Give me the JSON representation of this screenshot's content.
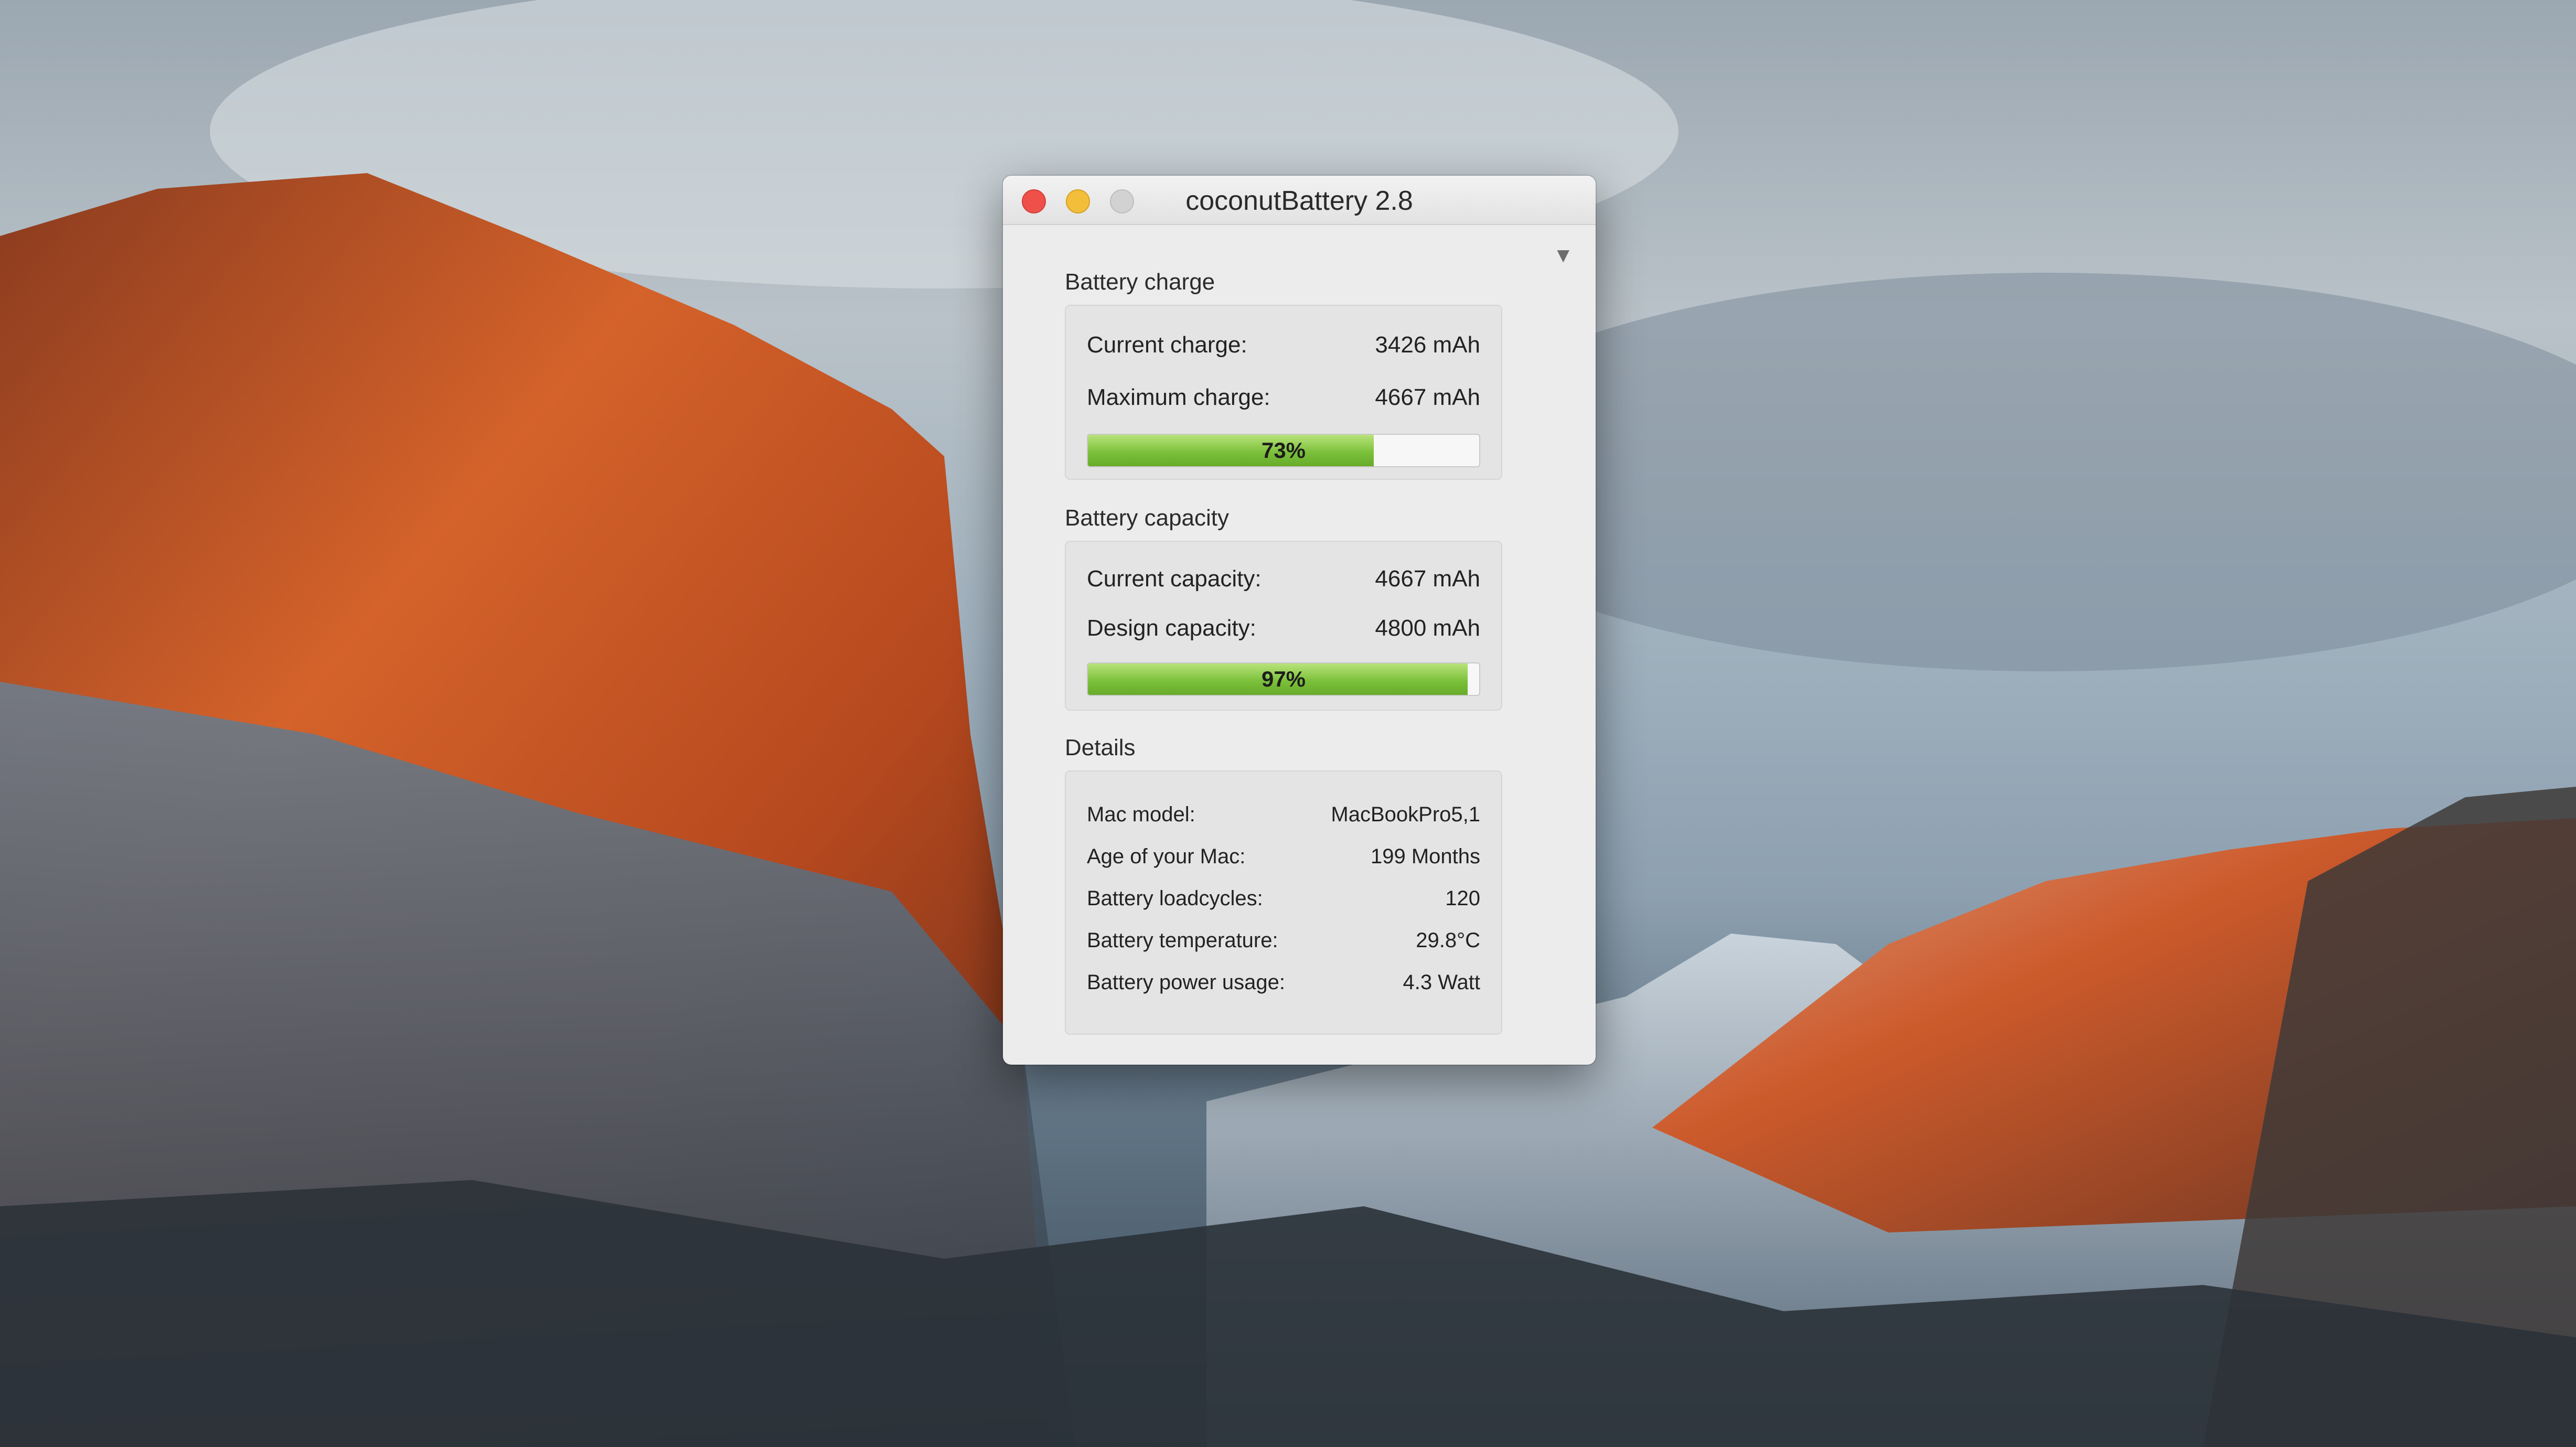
{
  "window": {
    "title": "coconutBattery 2.8"
  },
  "icons": {
    "close": "close-icon",
    "minimize": "minimize-icon",
    "zoom": "zoom-icon",
    "disclosure": "disclosure-triangle-icon",
    "disclosure_glyph": "▼"
  },
  "colors": {
    "close": "#f0504a",
    "minimize": "#f3be3a",
    "zoom": "#d2d2d2",
    "progress_green": "#7cc13b"
  },
  "battery_charge": {
    "title": "Battery charge",
    "current_label": "Current charge:",
    "current_value": "3426 mAh",
    "maximum_label": "Maximum charge:",
    "maximum_value": "4667 mAh",
    "percent_text": "73%",
    "percent": 73
  },
  "battery_capacity": {
    "title": "Battery capacity",
    "current_label": "Current capacity:",
    "current_value": "4667 mAh",
    "design_label": "Design capacity:",
    "design_value": "4800 mAh",
    "percent_text": "97%",
    "percent": 97
  },
  "details": {
    "title": "Details",
    "rows": [
      {
        "label": "Mac model:",
        "value": "MacBookPro5,1"
      },
      {
        "label": "Age of your Mac:",
        "value": "199 Months"
      },
      {
        "label": "Battery loadcycles:",
        "value": "120"
      },
      {
        "label": "Battery temperature:",
        "value": "29.8°C"
      },
      {
        "label": "Battery power usage:",
        "value": "4.3 Watt"
      }
    ]
  }
}
